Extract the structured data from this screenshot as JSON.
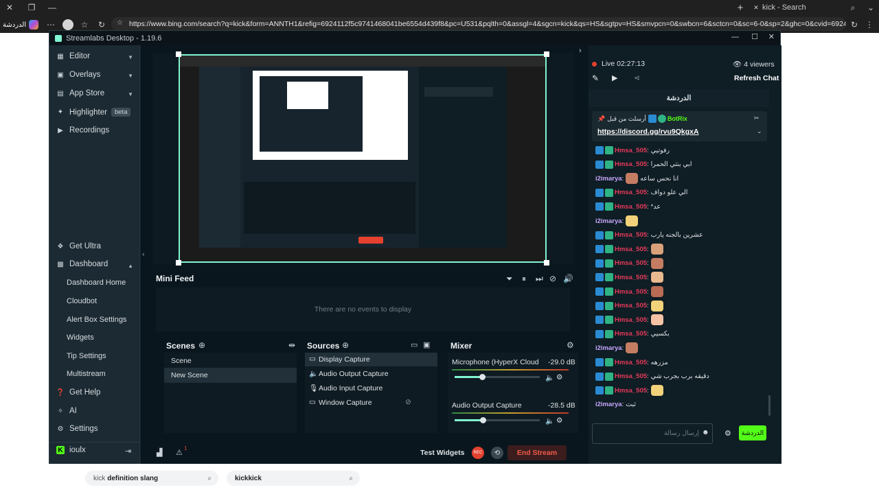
{
  "browser": {
    "tab_title": "kick - Search",
    "profile_label": "الدردشة",
    "url": "https://www.bing.com/search?q=kick&form=ANNTH1&refig=6924112f5c9741468041be6554d439f8&pc=U531&pqlth=0&assgl=4&sgcn=kick&qs=HS&sgtpv=HS&smvpcn=0&swbcn=6&sctcn=0&sc=6-0&sp=2&ghc=0&cvid=6924112f5c97414..."
  },
  "app": {
    "title": "Streamlabs Desktop - 1.19.6",
    "sidebar": {
      "items": [
        {
          "label": "Editor",
          "icon": "editor-icon"
        },
        {
          "label": "Overlays",
          "icon": "overlays-icon"
        },
        {
          "label": "App Store",
          "icon": "store-icon"
        },
        {
          "label": "Highlighter",
          "icon": "highlighter-icon",
          "badge": "beta"
        },
        {
          "label": "Recordings",
          "icon": "recordings-icon"
        }
      ],
      "bottom_items": [
        {
          "label": "Get Ultra"
        },
        {
          "label": "Dashboard"
        }
      ],
      "dashboard_sub": [
        "Dashboard Home",
        "Cloudbot",
        "Alert Box Settings",
        "Widgets",
        "Tip Settings",
        "Multistream"
      ],
      "footer_items": [
        {
          "label": "Get Help"
        },
        {
          "label": "AI"
        },
        {
          "label": "Settings"
        }
      ],
      "user": "ioulx"
    },
    "minifeed": {
      "title": "Mini Feed",
      "empty": "There are no events to display"
    },
    "scenes": {
      "title": "Scenes",
      "items": [
        "Scene",
        "New Scene"
      ]
    },
    "sources": {
      "title": "Sources",
      "items": [
        "Display Capture",
        "Audio Output Capture",
        "Audio Input Capture",
        "Window Capture"
      ]
    },
    "mixer": {
      "title": "Mixer",
      "channels": [
        {
          "name": "Microphone (HyperX Cloud II ...",
          "db": "-29.0 dB",
          "level": 0.32
        },
        {
          "name": "Audio Output Capture",
          "db": "-28.5 dB",
          "level": 0.33
        }
      ]
    },
    "footer": {
      "test_widgets": "Test Widgets",
      "end_stream": "End Stream",
      "rec": "REC",
      "alert_count": "1"
    }
  },
  "chat": {
    "live": "Live 02:27:13",
    "viewers": "4 viewers",
    "refresh": "Refresh Chat",
    "tab": "الدردشة",
    "pinned_user": "BotRix",
    "pinned_prefix": "أرسلت من قبل",
    "pinned_link": "https://discord.gg/rvu9QkgxA",
    "messages": [
      {
        "user": "Hmsa_505",
        "text": "رفوتيي",
        "type": "u1"
      },
      {
        "user": "Hmsa_505",
        "text": "ابي بنتي الحمرا",
        "type": "u1"
      },
      {
        "user": "i2imarya",
        "text": "انا نحس ساعه",
        "type": "u2",
        "emote": true
      },
      {
        "user": "Hmsa_505",
        "text": "الي علو دواف",
        "type": "u1"
      },
      {
        "user": "Hmsa_505",
        "text": "*عد",
        "type": "u1"
      },
      {
        "user": "i2imarya",
        "text": "",
        "type": "u2",
        "emote": true
      },
      {
        "user": "Hmsa_505",
        "text": "عشرين بالجنه يارب",
        "type": "u1"
      },
      {
        "user": "Hmsa_505",
        "text": "",
        "type": "u1",
        "emote": true
      },
      {
        "user": "Hmsa_505",
        "text": "",
        "type": "u1",
        "emote": true
      },
      {
        "user": "Hmsa_505",
        "text": "",
        "type": "u1",
        "emote": true
      },
      {
        "user": "Hmsa_505",
        "text": "",
        "type": "u1",
        "emote": true
      },
      {
        "user": "Hmsa_505",
        "text": "",
        "type": "u1",
        "emote": true
      },
      {
        "user": "Hmsa_505",
        "text": "",
        "type": "u1",
        "emote": true
      },
      {
        "user": "Hmsa_505",
        "text": "بكسيي",
        "type": "u1"
      },
      {
        "user": "i2imarya",
        "text": "",
        "type": "u2",
        "emote": true
      },
      {
        "user": "Hmsa_505",
        "text": "مزرهه",
        "type": "u1"
      },
      {
        "user": "Hmsa_505",
        "text": "دقيقه برب بجرب شي",
        "type": "u1"
      },
      {
        "user": "Hmsa_505",
        "text": "",
        "type": "u1",
        "emote": true
      },
      {
        "user": "i2imarya",
        "text": "ثبت",
        "type": "u2"
      }
    ],
    "input_placeholder": "إرسال رسالة",
    "send_label": "الدردشة"
  },
  "bing": {
    "pill1_prefix": "kick",
    "pill1_rest": "definition slang",
    "pill2": "kickkick"
  },
  "colors": {
    "accent": "#80f5d2",
    "end_stream": "#e4412f",
    "send": "#53fc18"
  }
}
